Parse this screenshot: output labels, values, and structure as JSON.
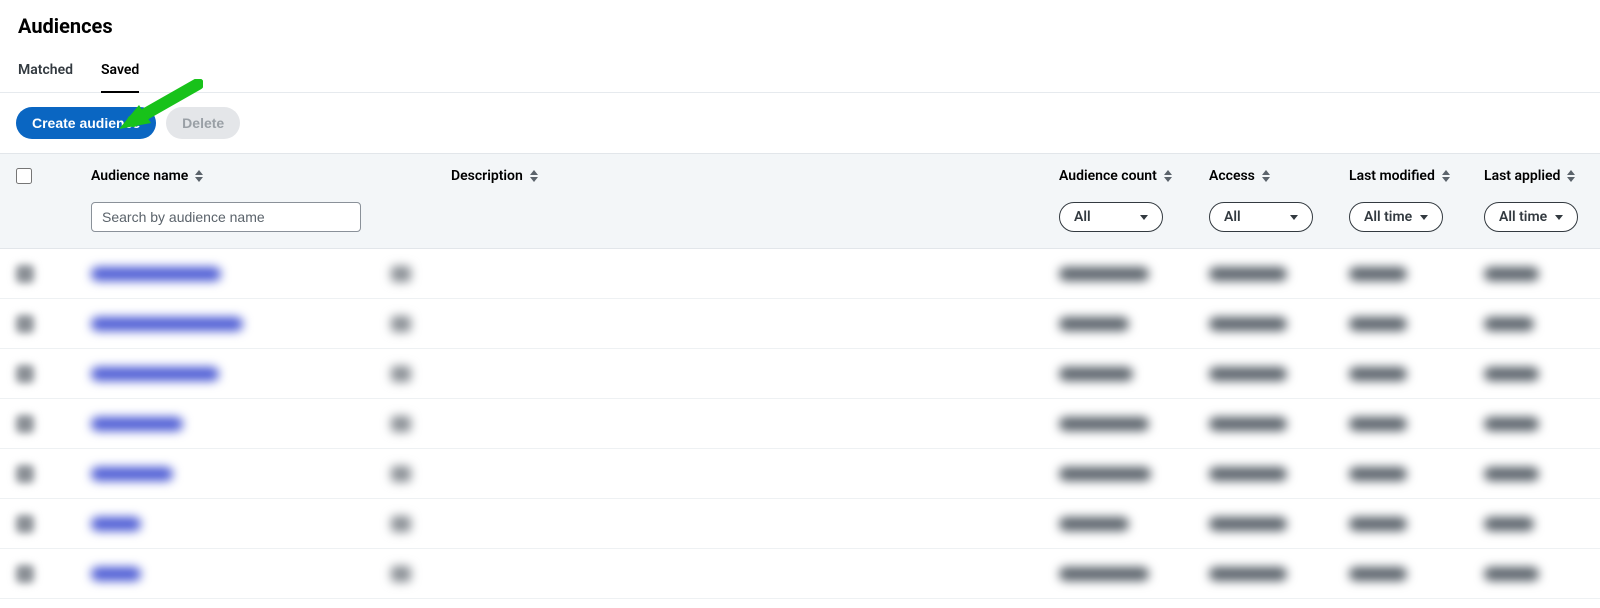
{
  "header": {
    "title": "Audiences"
  },
  "tabs": {
    "matched": "Matched",
    "saved": "Saved",
    "active": "saved"
  },
  "toolbar": {
    "create_label": "Create audience",
    "delete_label": "Delete"
  },
  "columns": {
    "name": "Audience name",
    "description": "Description",
    "count": "Audience count",
    "access": "Access",
    "modified": "Last modified",
    "applied": "Last applied"
  },
  "filters": {
    "search_placeholder": "Search by audience name",
    "count_value": "All",
    "access_value": "All",
    "modified_value": "All time",
    "applied_value": "All time"
  },
  "rows": [
    {
      "name_w": 130,
      "count_w": 90,
      "access_w": 78,
      "mod_w": 58,
      "app_w": 55
    },
    {
      "name_w": 152,
      "count_w": 70,
      "access_w": 78,
      "mod_w": 58,
      "app_w": 50
    },
    {
      "name_w": 128,
      "count_w": 74,
      "access_w": 78,
      "mod_w": 58,
      "app_w": 55
    },
    {
      "name_w": 92,
      "count_w": 90,
      "access_w": 78,
      "mod_w": 58,
      "app_w": 55
    },
    {
      "name_w": 82,
      "count_w": 92,
      "access_w": 78,
      "mod_w": 58,
      "app_w": 55
    },
    {
      "name_w": 50,
      "count_w": 70,
      "access_w": 78,
      "mod_w": 58,
      "app_w": 50
    },
    {
      "name_w": 50,
      "count_w": 90,
      "access_w": 78,
      "mod_w": 58,
      "app_w": 55
    }
  ]
}
